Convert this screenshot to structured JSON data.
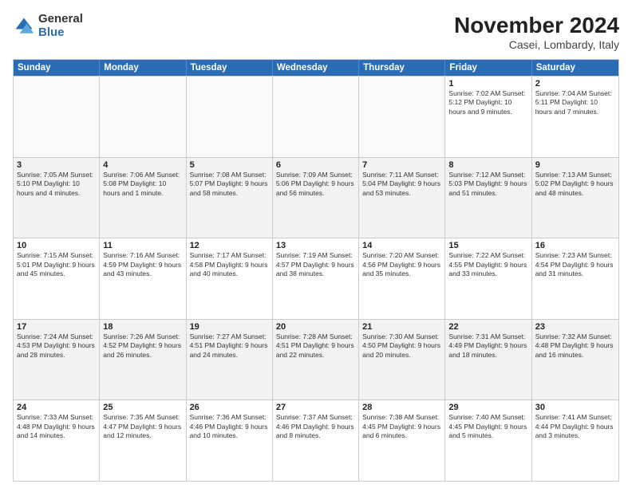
{
  "logo": {
    "general": "General",
    "blue": "Blue"
  },
  "title": "November 2024",
  "subtitle": "Casei, Lombardy, Italy",
  "headers": [
    "Sunday",
    "Monday",
    "Tuesday",
    "Wednesday",
    "Thursday",
    "Friday",
    "Saturday"
  ],
  "rows": [
    [
      {
        "day": "",
        "info": ""
      },
      {
        "day": "",
        "info": ""
      },
      {
        "day": "",
        "info": ""
      },
      {
        "day": "",
        "info": ""
      },
      {
        "day": "",
        "info": ""
      },
      {
        "day": "1",
        "info": "Sunrise: 7:02 AM\nSunset: 5:12 PM\nDaylight: 10 hours and 9 minutes."
      },
      {
        "day": "2",
        "info": "Sunrise: 7:04 AM\nSunset: 5:11 PM\nDaylight: 10 hours and 7 minutes."
      }
    ],
    [
      {
        "day": "3",
        "info": "Sunrise: 7:05 AM\nSunset: 5:10 PM\nDaylight: 10 hours and 4 minutes."
      },
      {
        "day": "4",
        "info": "Sunrise: 7:06 AM\nSunset: 5:08 PM\nDaylight: 10 hours and 1 minute."
      },
      {
        "day": "5",
        "info": "Sunrise: 7:08 AM\nSunset: 5:07 PM\nDaylight: 9 hours and 58 minutes."
      },
      {
        "day": "6",
        "info": "Sunrise: 7:09 AM\nSunset: 5:06 PM\nDaylight: 9 hours and 56 minutes."
      },
      {
        "day": "7",
        "info": "Sunrise: 7:11 AM\nSunset: 5:04 PM\nDaylight: 9 hours and 53 minutes."
      },
      {
        "day": "8",
        "info": "Sunrise: 7:12 AM\nSunset: 5:03 PM\nDaylight: 9 hours and 51 minutes."
      },
      {
        "day": "9",
        "info": "Sunrise: 7:13 AM\nSunset: 5:02 PM\nDaylight: 9 hours and 48 minutes."
      }
    ],
    [
      {
        "day": "10",
        "info": "Sunrise: 7:15 AM\nSunset: 5:01 PM\nDaylight: 9 hours and 45 minutes."
      },
      {
        "day": "11",
        "info": "Sunrise: 7:16 AM\nSunset: 4:59 PM\nDaylight: 9 hours and 43 minutes."
      },
      {
        "day": "12",
        "info": "Sunrise: 7:17 AM\nSunset: 4:58 PM\nDaylight: 9 hours and 40 minutes."
      },
      {
        "day": "13",
        "info": "Sunrise: 7:19 AM\nSunset: 4:57 PM\nDaylight: 9 hours and 38 minutes."
      },
      {
        "day": "14",
        "info": "Sunrise: 7:20 AM\nSunset: 4:56 PM\nDaylight: 9 hours and 35 minutes."
      },
      {
        "day": "15",
        "info": "Sunrise: 7:22 AM\nSunset: 4:55 PM\nDaylight: 9 hours and 33 minutes."
      },
      {
        "day": "16",
        "info": "Sunrise: 7:23 AM\nSunset: 4:54 PM\nDaylight: 9 hours and 31 minutes."
      }
    ],
    [
      {
        "day": "17",
        "info": "Sunrise: 7:24 AM\nSunset: 4:53 PM\nDaylight: 9 hours and 28 minutes."
      },
      {
        "day": "18",
        "info": "Sunrise: 7:26 AM\nSunset: 4:52 PM\nDaylight: 9 hours and 26 minutes."
      },
      {
        "day": "19",
        "info": "Sunrise: 7:27 AM\nSunset: 4:51 PM\nDaylight: 9 hours and 24 minutes."
      },
      {
        "day": "20",
        "info": "Sunrise: 7:28 AM\nSunset: 4:51 PM\nDaylight: 9 hours and 22 minutes."
      },
      {
        "day": "21",
        "info": "Sunrise: 7:30 AM\nSunset: 4:50 PM\nDaylight: 9 hours and 20 minutes."
      },
      {
        "day": "22",
        "info": "Sunrise: 7:31 AM\nSunset: 4:49 PM\nDaylight: 9 hours and 18 minutes."
      },
      {
        "day": "23",
        "info": "Sunrise: 7:32 AM\nSunset: 4:48 PM\nDaylight: 9 hours and 16 minutes."
      }
    ],
    [
      {
        "day": "24",
        "info": "Sunrise: 7:33 AM\nSunset: 4:48 PM\nDaylight: 9 hours and 14 minutes."
      },
      {
        "day": "25",
        "info": "Sunrise: 7:35 AM\nSunset: 4:47 PM\nDaylight: 9 hours and 12 minutes."
      },
      {
        "day": "26",
        "info": "Sunrise: 7:36 AM\nSunset: 4:46 PM\nDaylight: 9 hours and 10 minutes."
      },
      {
        "day": "27",
        "info": "Sunrise: 7:37 AM\nSunset: 4:46 PM\nDaylight: 9 hours and 8 minutes."
      },
      {
        "day": "28",
        "info": "Sunrise: 7:38 AM\nSunset: 4:45 PM\nDaylight: 9 hours and 6 minutes."
      },
      {
        "day": "29",
        "info": "Sunrise: 7:40 AM\nSunset: 4:45 PM\nDaylight: 9 hours and 5 minutes."
      },
      {
        "day": "30",
        "info": "Sunrise: 7:41 AM\nSunset: 4:44 PM\nDaylight: 9 hours and 3 minutes."
      }
    ]
  ]
}
